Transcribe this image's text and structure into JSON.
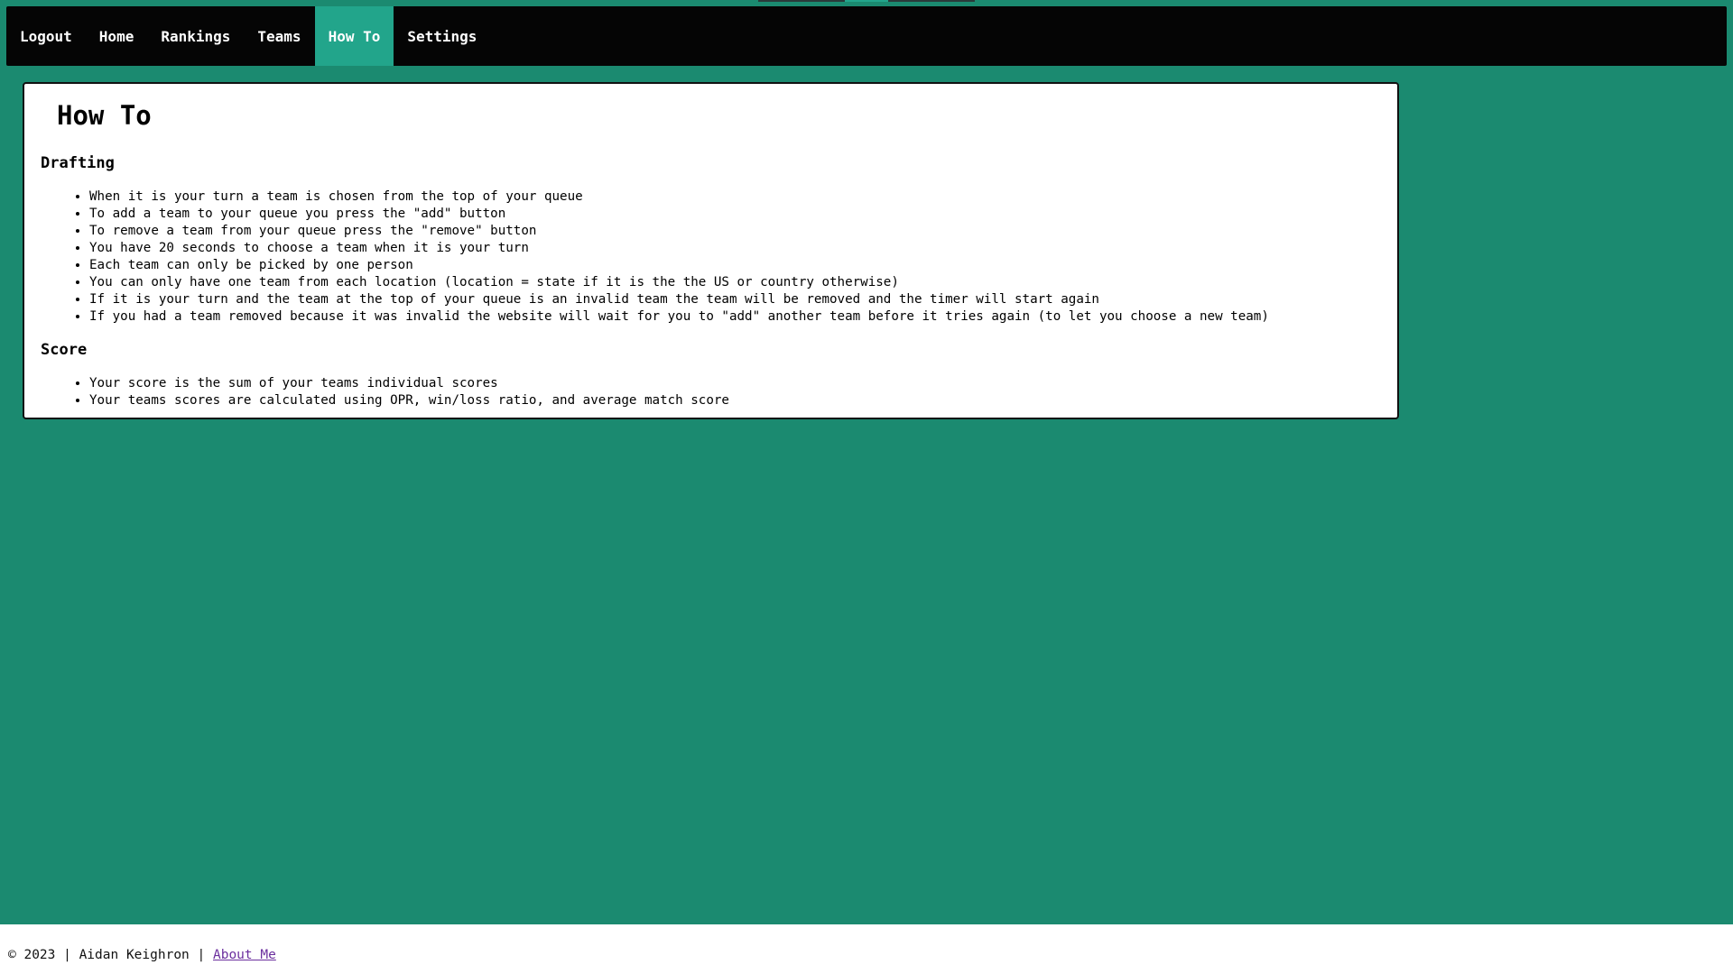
{
  "nav": {
    "items": [
      {
        "label": "Logout",
        "active": false
      },
      {
        "label": "Home",
        "active": false
      },
      {
        "label": "Rankings",
        "active": false
      },
      {
        "label": "Teams",
        "active": false
      },
      {
        "label": "How To",
        "active": true
      },
      {
        "label": "Settings",
        "active": false
      }
    ]
  },
  "page": {
    "title": "How To",
    "sections": [
      {
        "heading": "Drafting",
        "items": [
          "When it is your turn a team is chosen from the top of your queue",
          "To add a team to your queue you press the \"add\" button",
          "To remove a team from your queue press the \"remove\" button",
          "You have 20 seconds to choose a team when it is your turn",
          "Each team can only be picked by one person",
          "You can only have one team from each location (location = state if it is the the US or country otherwise)",
          "If it is your turn and the team at the top of your queue is an invalid team the team will be removed and the timer will start again",
          "If you had a team removed because it was invalid the website will wait for you to \"add\" another team before it tries again (to let you choose a new team)"
        ]
      },
      {
        "heading": "Score",
        "items": [
          "Your score is the sum of your teams individual scores",
          "Your teams scores are calculated using OPR, win/loss ratio, and average match score"
        ]
      }
    ]
  },
  "footer": {
    "text": "© 2023 | Aidan Keighron | ",
    "link_label": "About Me"
  },
  "colors": {
    "background": "#1b8a70",
    "nav_background": "#050505",
    "nav_active": "#22a58b",
    "card_background": "#ffffff",
    "link": "#6b2f9e"
  }
}
